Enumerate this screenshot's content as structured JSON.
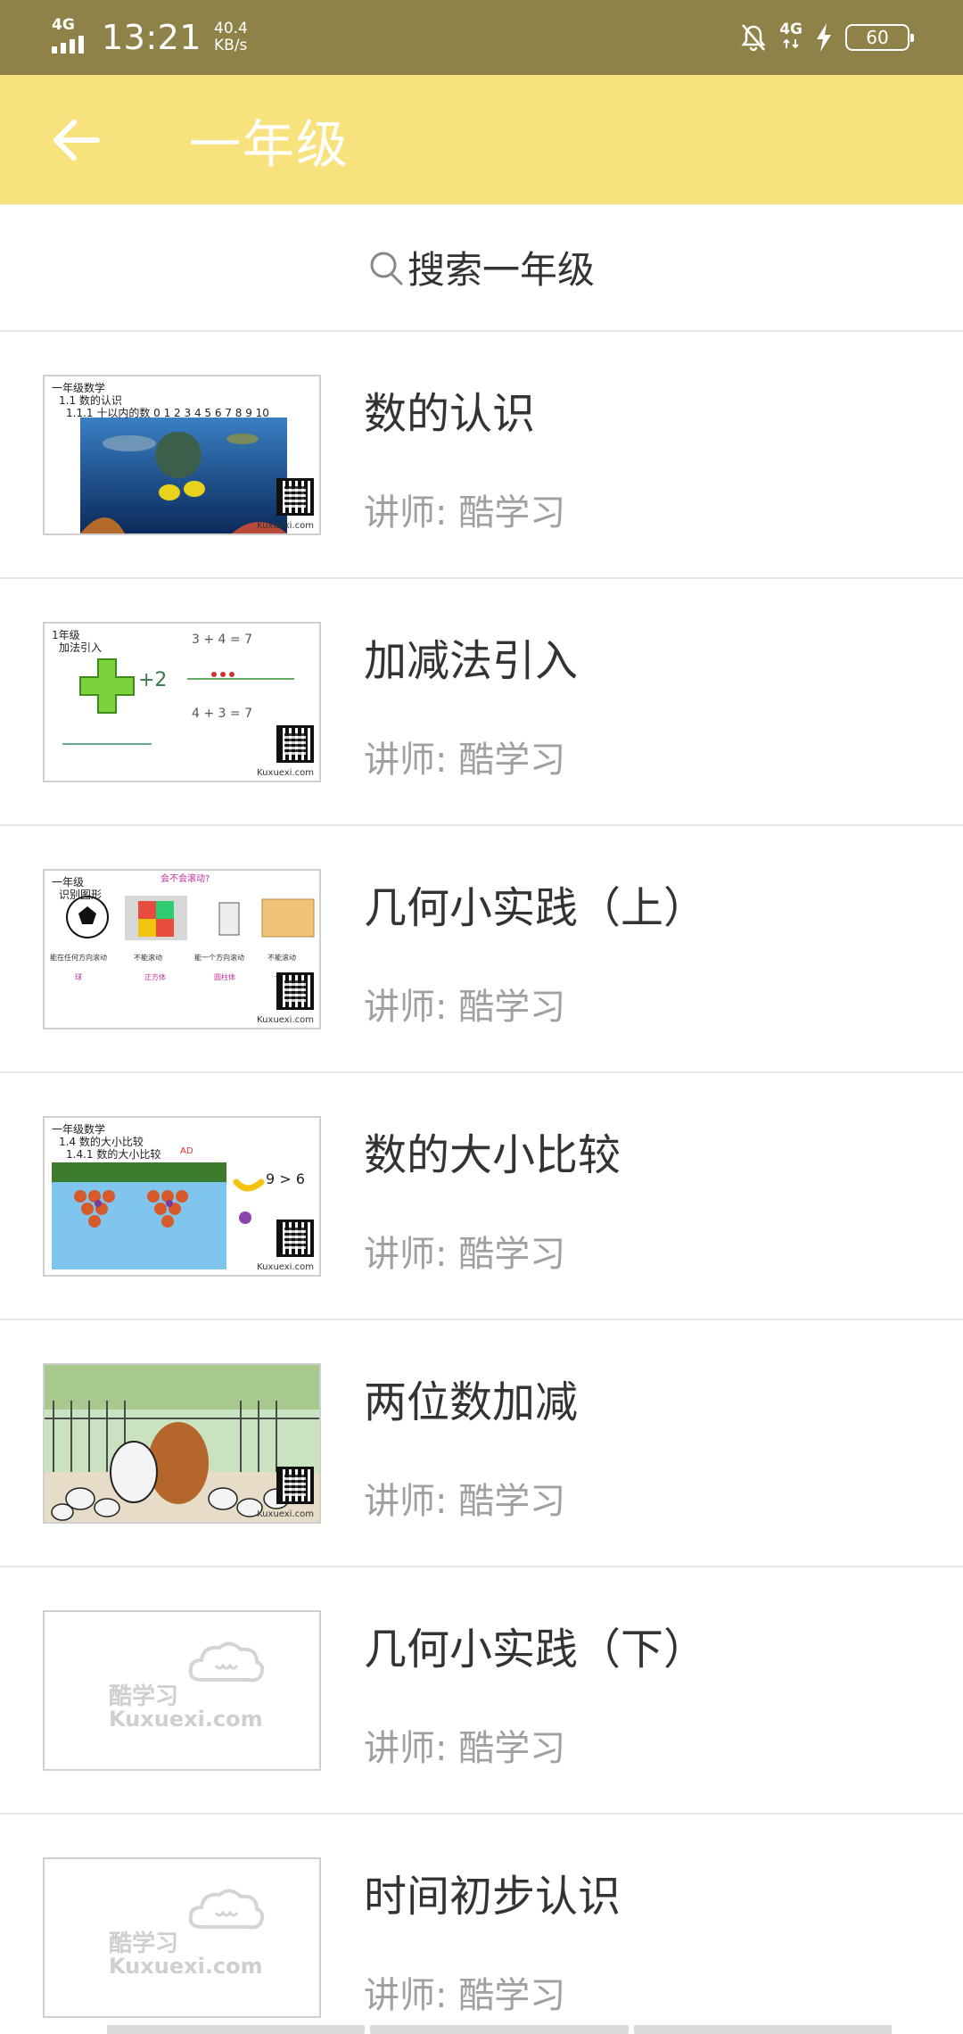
{
  "status_bar": {
    "signal_label": "4G",
    "time": "13:21",
    "speed_value": "40.4",
    "speed_unit": "KB/s",
    "net_label": "4G",
    "battery": "60"
  },
  "app_bar": {
    "title": "一年级"
  },
  "search": {
    "label": "搜索一年级"
  },
  "courses": [
    {
      "title": "数的认识",
      "teacher": "讲师: 酷学习",
      "thumb": {
        "type": "ocean",
        "caption": [
          "一年级数学",
          "1.1 数的认识",
          "1.1.1 十以内的数  0 1 2 3 4 5 6 7 8 9 10"
        ],
        "brand": "Kuxuexi.com"
      }
    },
    {
      "title": "加减法引入",
      "teacher": "讲师: 酷学习",
      "thumb": {
        "type": "whiteboard",
        "caption": [
          "1年级",
          "加法引入"
        ],
        "brand": "Kuxuexi.com"
      }
    },
    {
      "title": "几何小实践（上）",
      "teacher": "讲师: 酷学习",
      "thumb": {
        "type": "shapes",
        "caption": [
          "一年级",
          "识别图形"
        ],
        "brand": "Kuxuexi.com"
      }
    },
    {
      "title": "数的大小比较",
      "teacher": "讲师: 酷学习",
      "thumb": {
        "type": "fruit",
        "caption": [
          "一年级数学",
          "1.4 数的大小比较",
          "1.4.1 数的大小比较"
        ],
        "brand": "Kuxuexi.com"
      }
    },
    {
      "title": "两位数加减",
      "teacher": "讲师: 酷学习",
      "thumb": {
        "type": "dogs",
        "caption": [],
        "brand": "Kuxuexi.com"
      }
    },
    {
      "title": "几何小实践（下）",
      "teacher": "讲师: 酷学习",
      "thumb": {
        "type": "placeholder",
        "caption": [],
        "brand": "",
        "ph_cn": "酷学习",
        "ph_en": "Kuxuexi.com"
      }
    },
    {
      "title": "时间初步认识",
      "teacher": "讲师: 酷学习",
      "thumb": {
        "type": "placeholder",
        "caption": [],
        "brand": "",
        "ph_cn": "酷学习",
        "ph_en": "Kuxuexi.com"
      }
    }
  ],
  "colors": {
    "status_bar": "#8f8248",
    "app_bar": "#f8e27e",
    "divider": "#e6e6e6",
    "teacher_text": "#a0a0a0"
  }
}
